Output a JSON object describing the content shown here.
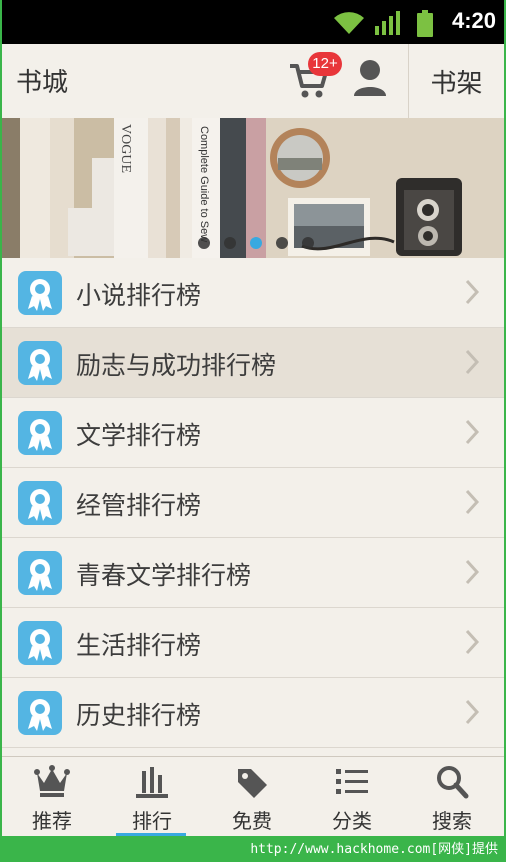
{
  "status_bar": {
    "time": "4:20"
  },
  "header": {
    "title": "书城",
    "cart_badge": "12+",
    "shelf_button": "书架"
  },
  "banner": {
    "book_titles": [
      "VOGUE",
      "Complete Guide to Sew"
    ],
    "slide_count": 5,
    "active_slide": 3
  },
  "rank_list": {
    "items": [
      {
        "label": "小说排行榜"
      },
      {
        "label": "励志与成功排行榜",
        "selected": true
      },
      {
        "label": "文学排行榜"
      },
      {
        "label": "经管排行榜"
      },
      {
        "label": "青春文学排行榜"
      },
      {
        "label": "生活排行榜"
      },
      {
        "label": "历史排行榜"
      }
    ]
  },
  "tabbar": {
    "tabs": [
      {
        "label": "推荐",
        "icon": "crown-icon"
      },
      {
        "label": "排行",
        "icon": "bar-chart-icon",
        "active": true
      },
      {
        "label": "免费",
        "icon": "tag-icon"
      },
      {
        "label": "分类",
        "icon": "list-icon"
      },
      {
        "label": "搜索",
        "icon": "search-icon"
      }
    ]
  },
  "watermark": "http://www.hackhome.com[网侠]提供",
  "colors": {
    "accent": "#38a9e0",
    "badge": "#e8363a",
    "status_green": "#8bc34a"
  }
}
